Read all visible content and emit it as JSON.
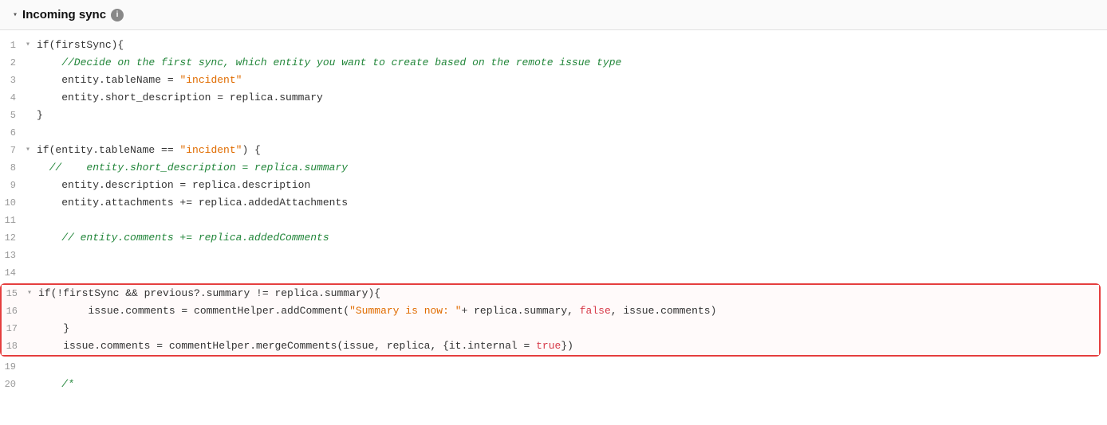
{
  "header": {
    "title": "Incoming sync",
    "chevron": "▾",
    "info_icon": "i"
  },
  "lines": [
    {
      "num": "1",
      "foldable": true,
      "content": [
        {
          "text": "if",
          "cls": "c-default"
        },
        {
          "text": "(firstSync){",
          "cls": "c-default"
        }
      ]
    },
    {
      "num": "2",
      "foldable": false,
      "content": [
        {
          "text": "    //Decide on the first sync, which entity you want to create based on the remote issue type",
          "cls": "c-comment"
        }
      ]
    },
    {
      "num": "3",
      "foldable": false,
      "content": [
        {
          "text": "    entity.tableName = ",
          "cls": "c-default"
        },
        {
          "text": "\"incident\"",
          "cls": "c-string"
        }
      ]
    },
    {
      "num": "4",
      "foldable": false,
      "content": [
        {
          "text": "    entity.short_description = replica.summary",
          "cls": "c-default"
        }
      ]
    },
    {
      "num": "5",
      "foldable": false,
      "content": [
        {
          "text": "}",
          "cls": "c-default"
        }
      ]
    },
    {
      "num": "6",
      "foldable": false,
      "content": []
    },
    {
      "num": "7",
      "foldable": true,
      "content": [
        {
          "text": "if",
          "cls": "c-default"
        },
        {
          "text": "(entity.tableName == ",
          "cls": "c-default"
        },
        {
          "text": "\"incident\"",
          "cls": "c-string"
        },
        {
          "text": ") {",
          "cls": "c-default"
        }
      ]
    },
    {
      "num": "8",
      "foldable": false,
      "content": [
        {
          "text": "  //    entity.short_description = replica.summary",
          "cls": "c-comment"
        }
      ]
    },
    {
      "num": "9",
      "foldable": false,
      "content": [
        {
          "text": "    entity.description = replica.description",
          "cls": "c-default"
        }
      ]
    },
    {
      "num": "10",
      "foldable": false,
      "content": [
        {
          "text": "    entity.attachments += replica.addedAttachments",
          "cls": "c-default"
        }
      ]
    },
    {
      "num": "11",
      "foldable": false,
      "content": []
    },
    {
      "num": "12",
      "foldable": false,
      "content": [
        {
          "text": "    // entity.comments += replica.addedComments",
          "cls": "c-comment"
        }
      ]
    },
    {
      "num": "13",
      "foldable": false,
      "content": []
    },
    {
      "num": "14",
      "foldable": false,
      "content": []
    },
    {
      "num": "15",
      "foldable": true,
      "highlighted": true,
      "content": [
        {
          "text": "if",
          "cls": "c-default"
        },
        {
          "text": "(!firstSync && previous?.summary != replica.summary){",
          "cls": "c-default"
        }
      ]
    },
    {
      "num": "16",
      "foldable": false,
      "highlighted": true,
      "content": [
        {
          "text": "        issue.comments = commentHelper.addComment(",
          "cls": "c-default"
        },
        {
          "text": "\"Summary is now: \"",
          "cls": "c-string"
        },
        {
          "text": "+ replica.summary, ",
          "cls": "c-default"
        },
        {
          "text": "false",
          "cls": "c-magenta"
        },
        {
          "text": ", issue.comments)",
          "cls": "c-default"
        }
      ]
    },
    {
      "num": "17",
      "foldable": false,
      "highlighted": true,
      "content": [
        {
          "text": "    }",
          "cls": "c-default"
        }
      ]
    },
    {
      "num": "18",
      "foldable": false,
      "highlighted": true,
      "content": [
        {
          "text": "    issue.comments = commentHelper.mergeComments(issue, replica, {it.internal = ",
          "cls": "c-default"
        },
        {
          "text": "true",
          "cls": "c-magenta"
        },
        {
          "text": "})",
          "cls": "c-default"
        }
      ]
    },
    {
      "num": "19",
      "foldable": false,
      "content": []
    },
    {
      "num": "20",
      "foldable": false,
      "content": [
        {
          "text": "    /*",
          "cls": "c-comment"
        }
      ]
    }
  ]
}
